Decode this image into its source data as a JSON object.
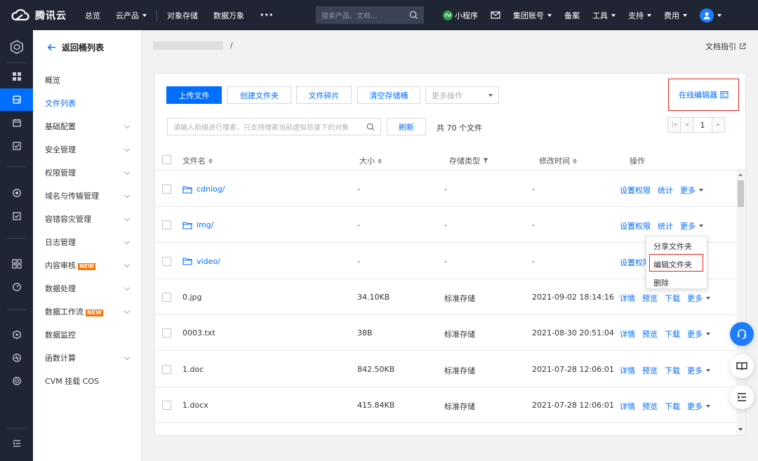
{
  "topbar": {
    "logo_text": "腾讯云",
    "nav": [
      {
        "label": "总览",
        "has_caret": false
      },
      {
        "label": "云产品",
        "has_caret": true
      },
      {
        "label": "对象存储",
        "has_caret": false
      },
      {
        "label": "数据万象",
        "has_caret": false
      },
      {
        "label": "•••",
        "has_caret": false
      }
    ],
    "search_placeholder": "搜索产品、文档...",
    "right": {
      "mini_program": "小程序",
      "group_account": "集团账号",
      "filing": "备案",
      "tools": "工具",
      "support": "支持",
      "billing": "费用"
    }
  },
  "sidebar": {
    "back_label": "返回桶列表",
    "items": [
      {
        "label": "概览",
        "chevron": false,
        "active": false,
        "badge": ""
      },
      {
        "label": "文件列表",
        "chevron": false,
        "active": true,
        "badge": ""
      },
      {
        "label": "基础配置",
        "chevron": true,
        "active": false,
        "badge": ""
      },
      {
        "label": "安全管理",
        "chevron": true,
        "active": false,
        "badge": ""
      },
      {
        "label": "权限管理",
        "chevron": true,
        "active": false,
        "badge": ""
      },
      {
        "label": "域名与传输管理",
        "chevron": true,
        "active": false,
        "badge": ""
      },
      {
        "label": "容错容灾管理",
        "chevron": true,
        "active": false,
        "badge": ""
      },
      {
        "label": "日志管理",
        "chevron": true,
        "active": false,
        "badge": ""
      },
      {
        "label": "内容审核",
        "chevron": true,
        "active": false,
        "badge": "NEW"
      },
      {
        "label": "数据处理",
        "chevron": true,
        "active": false,
        "badge": ""
      },
      {
        "label": "数据工作流",
        "chevron": true,
        "active": false,
        "badge": "NEW"
      },
      {
        "label": "数据监控",
        "chevron": false,
        "active": false,
        "badge": ""
      },
      {
        "label": "函数计算",
        "chevron": true,
        "active": false,
        "badge": ""
      },
      {
        "label": "CVM 挂载 COS",
        "chevron": false,
        "active": false,
        "badge": ""
      }
    ]
  },
  "breadcrumb": {
    "separator": "/"
  },
  "doc_link": "文档指引",
  "toolbar": {
    "upload": "上传文件",
    "create_folder": "创建文件夹",
    "fragments": "文件碎片",
    "clear_bucket": "清空存储桶",
    "more_ops_placeholder": "更多操作",
    "online_editor": "在线编辑器"
  },
  "search": {
    "placeholder": "请输入前缀进行搜索，只支持搜索当前虚拟目录下的对象",
    "refresh": "刷新",
    "count_text": "共 70 个文件"
  },
  "pager": {
    "page": "1"
  },
  "table": {
    "headers": {
      "name": "文件名",
      "size": "大小",
      "storage_class": "存储类型",
      "modified": "修改时间",
      "actions": "操作"
    },
    "rows": [
      {
        "name": "cdnlog/",
        "folder": true,
        "size": "-",
        "storage": "-",
        "modified": "-",
        "ops": [
          "设置权限",
          "统计"
        ],
        "more": "更多"
      },
      {
        "name": "img/",
        "folder": true,
        "size": "-",
        "storage": "-",
        "modified": "-",
        "ops": [
          "设置权限",
          "统计"
        ],
        "more": "更多"
      },
      {
        "name": "video/",
        "folder": true,
        "size": "-",
        "storage": "-",
        "modified": "-",
        "ops": [
          "设置权限"
        ],
        "more": ""
      },
      {
        "name": "0.jpg",
        "folder": false,
        "size": "34.10KB",
        "storage": "标准存储",
        "modified": "2021-09-02 18:14:16",
        "ops": [
          "详情",
          "预览",
          "下载"
        ],
        "more": "更多"
      },
      {
        "name": "0003.txt",
        "folder": false,
        "size": "38B",
        "storage": "标准存储",
        "modified": "2021-08-30 20:51:04",
        "ops": [
          "详情",
          "预览",
          "下载"
        ],
        "more": "更多"
      },
      {
        "name": "1.doc",
        "folder": false,
        "size": "842.50KB",
        "storage": "标准存储",
        "modified": "2021-07-28 12:06:01",
        "ops": [
          "详情",
          "预览",
          "下载"
        ],
        "more": "更多"
      },
      {
        "name": "1.docx",
        "folder": false,
        "size": "415.84KB",
        "storage": "标准存储",
        "modified": "2021-07-28 12:06:01",
        "ops": [
          "详情",
          "预览",
          "下载"
        ],
        "more": "更多"
      }
    ]
  },
  "dropdown": {
    "items": [
      "分享文件夹",
      "编辑文件夹",
      "删除"
    ]
  },
  "colors": {
    "accent": "#006eff",
    "topbar": "#1f2533",
    "highlight": "#e1251b",
    "new_badge": "#ff7200"
  }
}
